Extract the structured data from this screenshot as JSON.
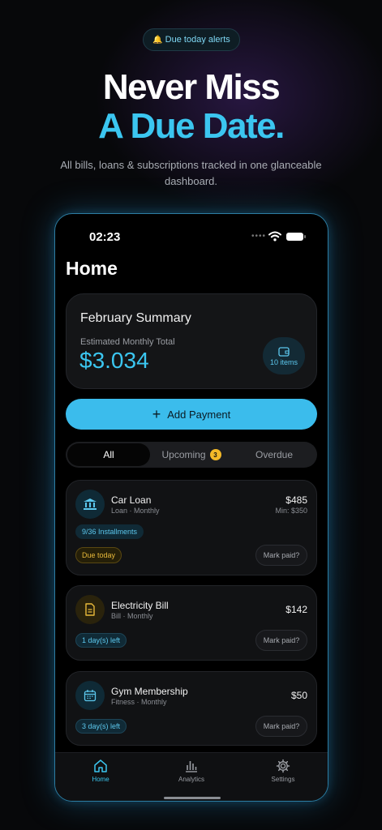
{
  "promo": {
    "badge": "Due today alerts",
    "headline_line1": "Never Miss",
    "headline_line2": "A Due Date.",
    "subtitle": "All bills, loans & subscriptions tracked in one glanceable dashboard."
  },
  "status_bar": {
    "time": "02:23"
  },
  "screen": {
    "title": "Home"
  },
  "summary": {
    "title": "February Summary",
    "label": "Estimated Monthly Total",
    "amount": "$3.034",
    "items": "10 items"
  },
  "add_button": {
    "label": "Add Payment"
  },
  "filters": {
    "all": "All",
    "upcoming": "Upcoming",
    "upcoming_count": "3",
    "overdue": "Overdue"
  },
  "payments": [
    {
      "title": "Car Loan",
      "subtitle": "Loan · Monthly",
      "amount": "$485",
      "min": "Min: $350",
      "installments": "9/36 Installments",
      "status": "Due today",
      "action": "Mark paid?",
      "icon": "bank-icon"
    },
    {
      "title": "Electricity Bill",
      "subtitle": "Bill · Monthly",
      "amount": "$142",
      "status": "1 day(s) left",
      "action": "Mark paid?",
      "icon": "document-icon"
    },
    {
      "title": "Gym Membership",
      "subtitle": "Fitness · Monthly",
      "amount": "$50",
      "status": "3 day(s) left",
      "action": "Mark paid?",
      "icon": "calendar-icon"
    }
  ],
  "tabbar": {
    "home": "Home",
    "analytics": "Analytics",
    "settings": "Settings"
  },
  "colors": {
    "accent": "#3bc6f0",
    "button": "#3bbcec",
    "warning": "#f4b928",
    "background": "#07080a"
  }
}
